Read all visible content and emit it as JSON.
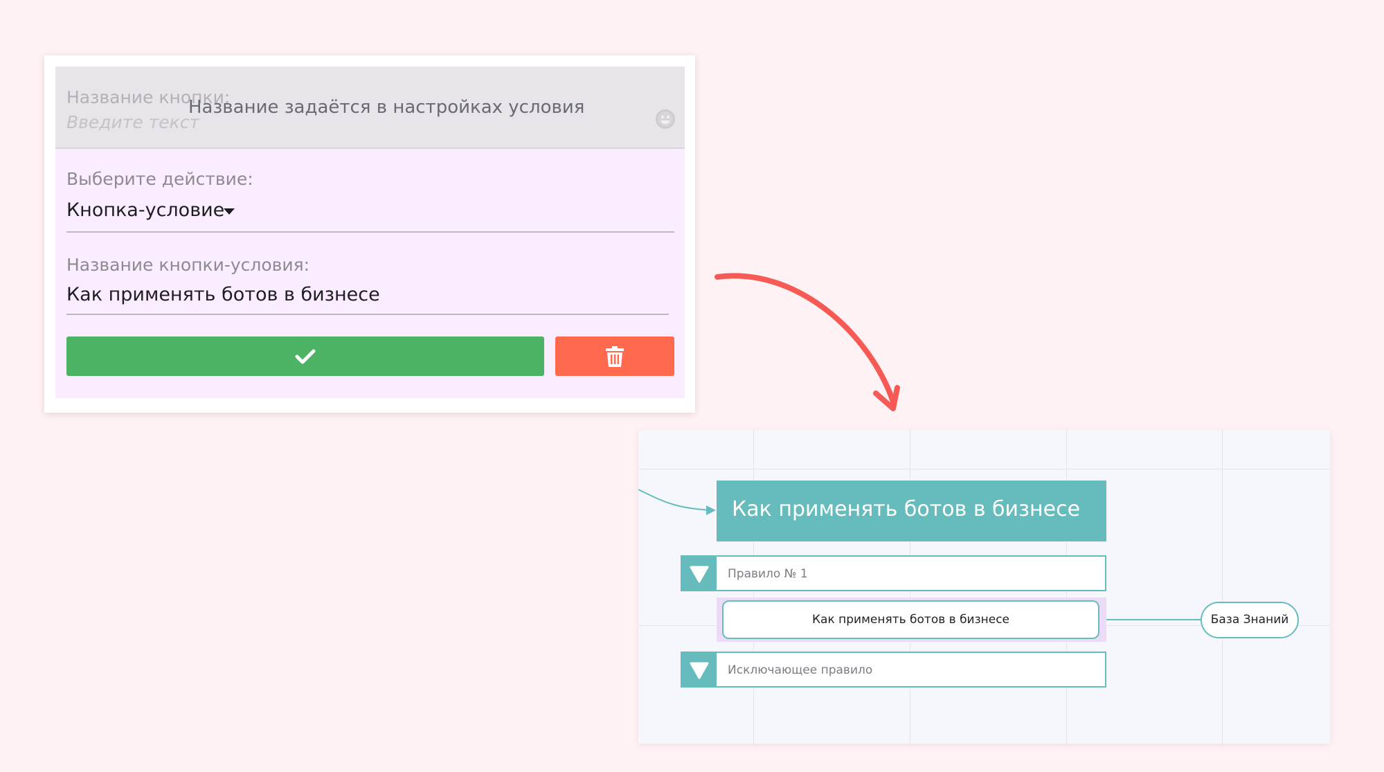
{
  "form": {
    "disabled_field": {
      "label": "Название кнопки:",
      "placeholder": "Введите текст",
      "overlay_text": "Название задаётся в настройках условия"
    },
    "action": {
      "label": "Выберите действие:",
      "value": "Кнопка-условие"
    },
    "condition_name": {
      "label": "Название кнопки-условия:",
      "value": "Как применять ботов в бизнесе"
    },
    "buttons": {
      "confirm_icon": "check-icon",
      "delete_icon": "trash-icon"
    }
  },
  "flow": {
    "block_title": "Как применять ботов в бизнесе",
    "rules": [
      {
        "label": "Правило № 1"
      },
      {
        "label": "Исключающее правило"
      }
    ],
    "condition_button": "Как применять ботов в бизнесе",
    "linked_block": "База Знаний"
  },
  "colors": {
    "background": "#fff2f4",
    "confirm": "#4db364",
    "delete": "#ff6a4f",
    "teal": "#66bcbc",
    "arrow": "#f55a55"
  }
}
